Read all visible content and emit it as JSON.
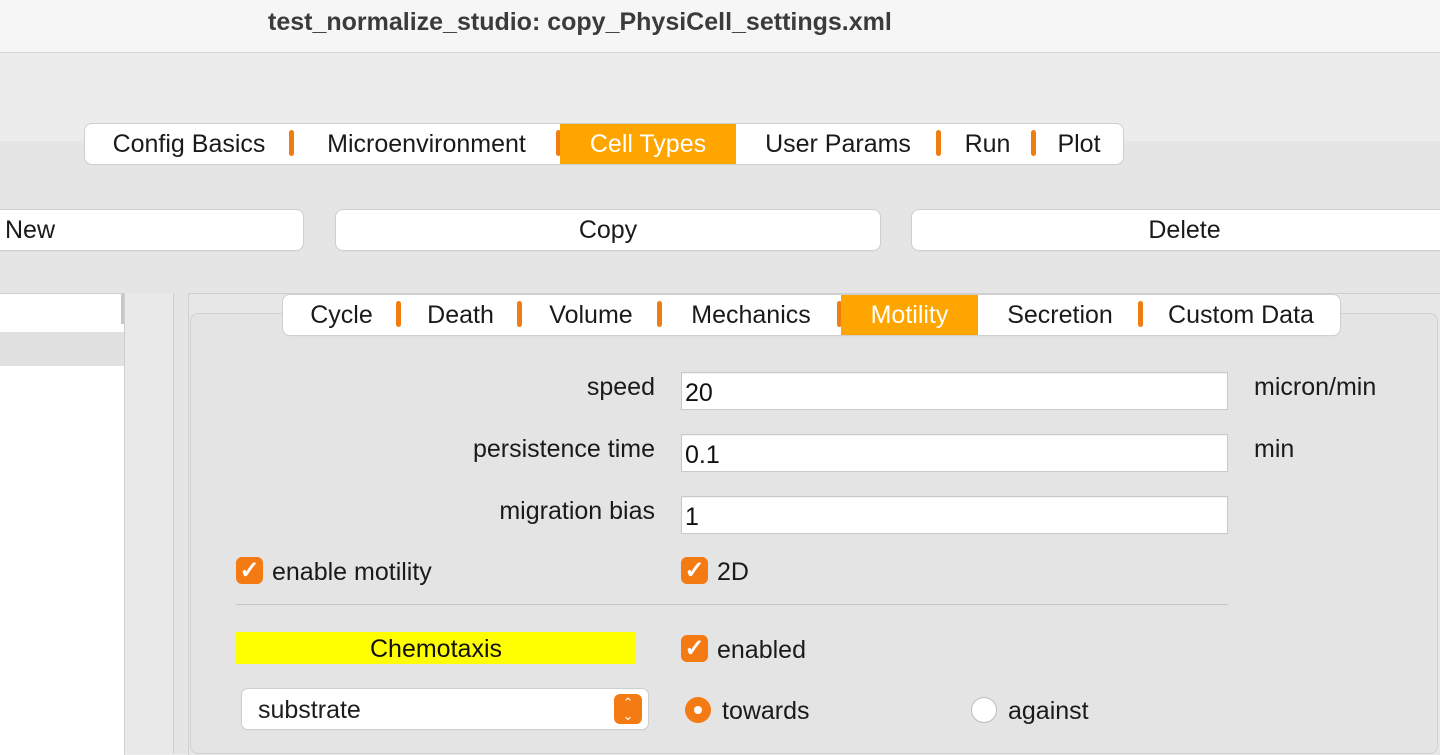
{
  "window": {
    "title": "test_normalize_studio: copy_PhysiCell_settings.xml"
  },
  "main_tabs": [
    {
      "label": "Config Basics",
      "active": false
    },
    {
      "label": "Microenvironment",
      "active": false
    },
    {
      "label": "Cell Types",
      "active": true
    },
    {
      "label": "User Params",
      "active": false
    },
    {
      "label": "Run",
      "active": false
    },
    {
      "label": "Plot",
      "active": false
    }
  ],
  "actions": {
    "new_label": "New",
    "copy_label": "Copy",
    "delete_label": "Delete"
  },
  "sub_tabs": [
    {
      "label": "Cycle",
      "active": false
    },
    {
      "label": "Death",
      "active": false
    },
    {
      "label": "Volume",
      "active": false
    },
    {
      "label": "Mechanics",
      "active": false
    },
    {
      "label": "Motility",
      "active": true
    },
    {
      "label": "Secretion",
      "active": false
    },
    {
      "label": "Custom Data",
      "active": false
    }
  ],
  "motility": {
    "speed": {
      "label": "speed",
      "value": "20",
      "units": "micron/min"
    },
    "persistence_time": {
      "label": "persistence time",
      "value": "0.1",
      "units": "min"
    },
    "migration_bias": {
      "label": "migration bias",
      "value": "1"
    },
    "enable_motility": {
      "label": "enable motility",
      "checked": true
    },
    "two_d": {
      "label": "2D",
      "checked": true
    }
  },
  "chemotaxis": {
    "header": "Chemotaxis",
    "enabled": {
      "label": "enabled",
      "checked": true
    },
    "substrate": {
      "selected": "substrate"
    },
    "direction": {
      "towards_label": "towards",
      "against_label": "against",
      "selected": "towards"
    }
  },
  "colors": {
    "accent": "#ffa500",
    "checkbox": "#f47a14",
    "chemotaxis_bg": "#ffff00"
  },
  "icons": {
    "check": "checkmark-icon",
    "stepper": "chevron-up-down-icon"
  }
}
